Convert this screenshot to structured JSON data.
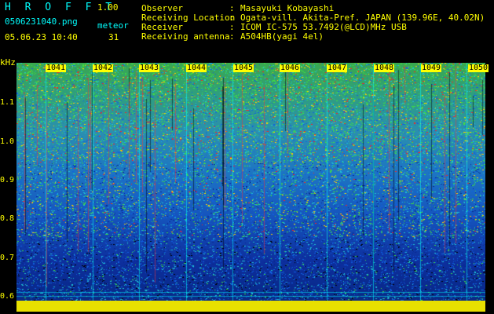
{
  "header": {
    "app_name": "H R O F F T",
    "version": "1.00",
    "filename": "0506231040.png",
    "observation_type": "meteor",
    "datetime": "05.06.23 10:40",
    "count": "31"
  },
  "info": [
    {
      "label": "Observer",
      "value": "Masayuki Kobayashi"
    },
    {
      "label": "Receiving Location",
      "value": "Ogata-vill. Akita-Pref. JAPAN (139.96E, 40.02N)"
    },
    {
      "label": "Receiver",
      "value": "ICOM IC-575 53.7492(@LCD)MHz USB"
    },
    {
      "label": "Receiving antenna",
      "value": "A504HB(yagi 4el)"
    }
  ],
  "axes": {
    "y_unit": "kHz",
    "y_ticks": [
      "1.1",
      "1.0",
      "0.9",
      "0.8",
      "0.7",
      "0.6"
    ],
    "x_ticks": [
      "1041",
      "1042",
      "1043",
      "1044",
      "1045",
      "1046",
      "1047",
      "1048",
      "1049",
      "1050"
    ]
  },
  "colors": {
    "label_text": "#ffff00",
    "header_cyan": "#00ffff",
    "background": "#000000"
  }
}
